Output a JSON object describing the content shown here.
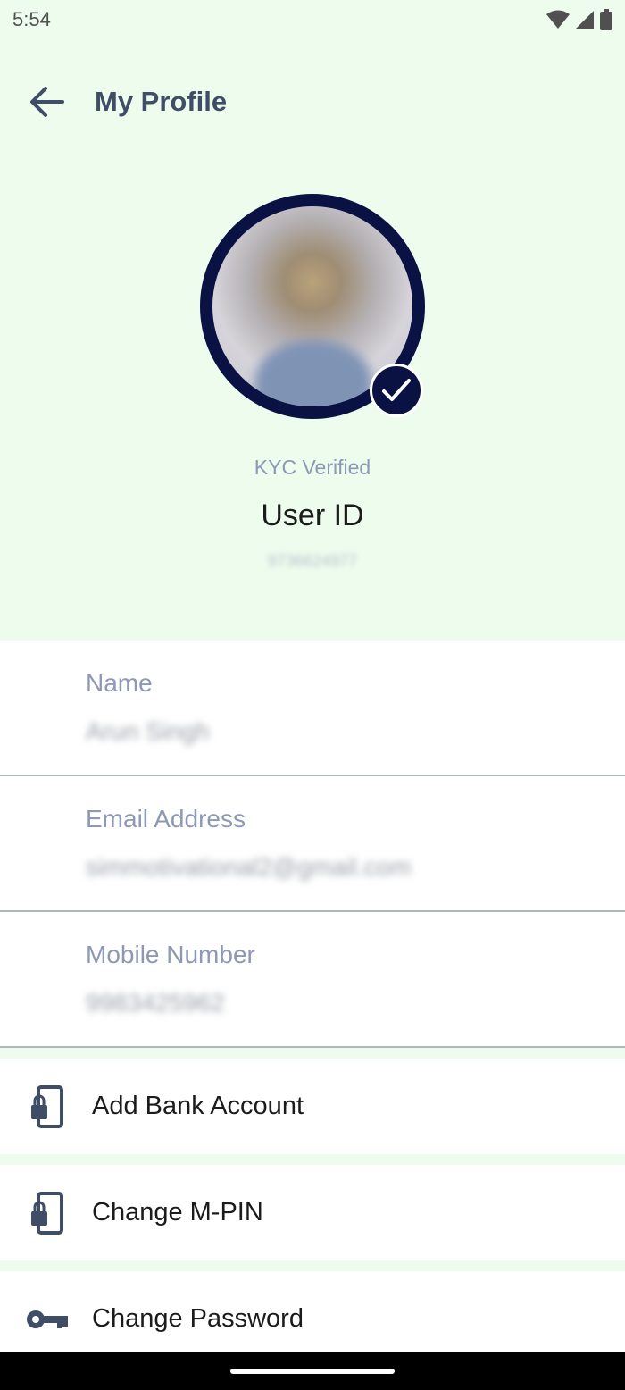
{
  "status_bar": {
    "time": "5:54",
    "icons": [
      "wifi-icon",
      "signal-icon",
      "battery-icon"
    ]
  },
  "header": {
    "title": "My Profile",
    "back_icon": "arrow-left-icon"
  },
  "profile": {
    "kyc_status": "KYC Verified",
    "user_id_label": "User ID",
    "user_id_value": "9736624977",
    "badge_icon": "check-icon",
    "ring_color": "#0a1244"
  },
  "details": [
    {
      "label": "Name",
      "value": "Arun Singh"
    },
    {
      "label": "Email Address",
      "value": "simmotivational2@gmail.com"
    },
    {
      "label": "Mobile Number",
      "value": "9983425962"
    }
  ],
  "menu": [
    {
      "label": "Add Bank Account",
      "icon": "phone-lock-icon"
    },
    {
      "label": "Change M-PIN",
      "icon": "phone-lock-icon"
    },
    {
      "label": "Change Password",
      "icon": "key-icon"
    }
  ],
  "colors": {
    "background": "#edfced",
    "title": "#3f4d67",
    "muted_label": "#8c98b5",
    "icon": "#3f4d67"
  }
}
